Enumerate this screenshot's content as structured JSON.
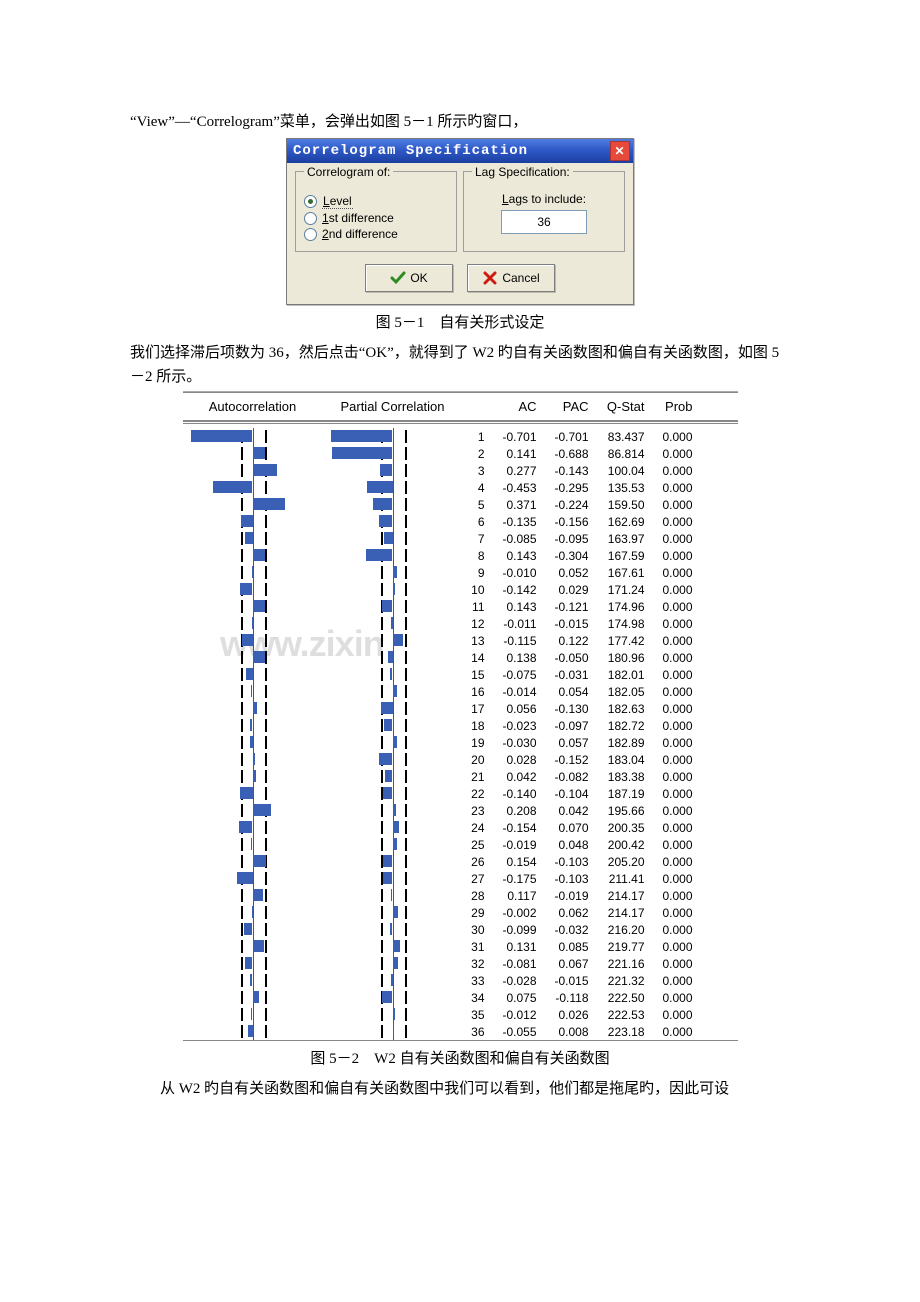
{
  "paragraphs": {
    "line1": "“View”—“Correlogram”菜单，会弹出如图 5－1 所示旳窗口，",
    "caption_5_1": "图 5－1　自有关形式设定",
    "after_5_1": "我们选择滞后项数为 36，然后点击“OK”，就得到了 W2 旳自有关函数图和偏自有关函数图，如图 5－2 所示。",
    "caption_5_2": "图 5－2　W2 自有关函数图和偏自有关函数图",
    "after_5_2": "从 W2 旳自有关函数图和偏自有关函数图中我们可以看到，他们都是拖尾旳，因此可设"
  },
  "dialog": {
    "title": "Correlogram Specification",
    "left_legend": "Correlogram of:",
    "radios": {
      "level": {
        "label": "Level",
        "underline": "L",
        "checked": true
      },
      "first": {
        "label": "1st difference",
        "underline": "1",
        "checked": false
      },
      "second": {
        "label": "2nd difference",
        "underline": "2",
        "checked": false
      }
    },
    "right_legend": "Lag Specification:",
    "lags_label": "Lags to include:",
    "lags_underline": "L",
    "lags_value": "36",
    "ok_label": "OK",
    "cancel_label": "Cancel"
  },
  "correlogram": {
    "headers": {
      "ac": "Autocorrelation",
      "pac": "Partial Correlation",
      "lag": "",
      "v1": "AC",
      "v2": "PAC",
      "q": "Q-Stat",
      "p": "Prob"
    },
    "ci": 0.12
  },
  "chart_data": {
    "type": "table",
    "title": "W2 correlogram (AC, PAC, Q-Stat, Prob) with lags 1–36",
    "columns": [
      "lag",
      "AC",
      "PAC",
      "Q-Stat",
      "Prob"
    ],
    "rows": [
      [
        1,
        -0.701,
        -0.701,
        83.437,
        0.0
      ],
      [
        2,
        0.141,
        -0.688,
        86.814,
        0.0
      ],
      [
        3,
        0.277,
        -0.143,
        100.04,
        0.0
      ],
      [
        4,
        -0.453,
        -0.295,
        135.53,
        0.0
      ],
      [
        5,
        0.371,
        -0.224,
        159.5,
        0.0
      ],
      [
        6,
        -0.135,
        -0.156,
        162.69,
        0.0
      ],
      [
        7,
        -0.085,
        -0.095,
        163.97,
        0.0
      ],
      [
        8,
        0.143,
        -0.304,
        167.59,
        0.0
      ],
      [
        9,
        -0.01,
        0.052,
        167.61,
        0.0
      ],
      [
        10,
        -0.142,
        0.029,
        171.24,
        0.0
      ],
      [
        11,
        0.143,
        -0.121,
        174.96,
        0.0
      ],
      [
        12,
        -0.011,
        -0.015,
        174.98,
        0.0
      ],
      [
        13,
        -0.115,
        0.122,
        177.42,
        0.0
      ],
      [
        14,
        0.138,
        -0.05,
        180.96,
        0.0
      ],
      [
        15,
        -0.075,
        -0.031,
        182.01,
        0.0
      ],
      [
        16,
        -0.014,
        0.054,
        182.05,
        0.0
      ],
      [
        17,
        0.056,
        -0.13,
        182.63,
        0.0
      ],
      [
        18,
        -0.023,
        -0.097,
        182.72,
        0.0
      ],
      [
        19,
        -0.03,
        0.057,
        182.89,
        0.0
      ],
      [
        20,
        0.028,
        -0.152,
        183.04,
        0.0
      ],
      [
        21,
        0.042,
        -0.082,
        183.38,
        0.0
      ],
      [
        22,
        -0.14,
        -0.104,
        187.19,
        0.0
      ],
      [
        23,
        0.208,
        0.042,
        195.66,
        0.0
      ],
      [
        24,
        -0.154,
        0.07,
        200.35,
        0.0
      ],
      [
        25,
        -0.019,
        0.048,
        200.42,
        0.0
      ],
      [
        26,
        0.154,
        -0.103,
        205.2,
        0.0
      ],
      [
        27,
        -0.175,
        -0.103,
        211.41,
        0.0
      ],
      [
        28,
        0.117,
        -0.019,
        214.17,
        0.0
      ],
      [
        29,
        -0.002,
        0.062,
        214.17,
        0.0
      ],
      [
        30,
        -0.099,
        -0.032,
        216.2,
        0.0
      ],
      [
        31,
        0.131,
        0.085,
        219.77,
        0.0
      ],
      [
        32,
        -0.081,
        0.067,
        221.16,
        0.0
      ],
      [
        33,
        -0.028,
        -0.015,
        221.32,
        0.0
      ],
      [
        34,
        0.075,
        -0.118,
        222.5,
        0.0
      ],
      [
        35,
        -0.012,
        0.026,
        222.53,
        0.0
      ],
      [
        36,
        -0.055,
        0.008,
        223.18,
        0.0
      ]
    ]
  },
  "watermark": "www.zixin"
}
